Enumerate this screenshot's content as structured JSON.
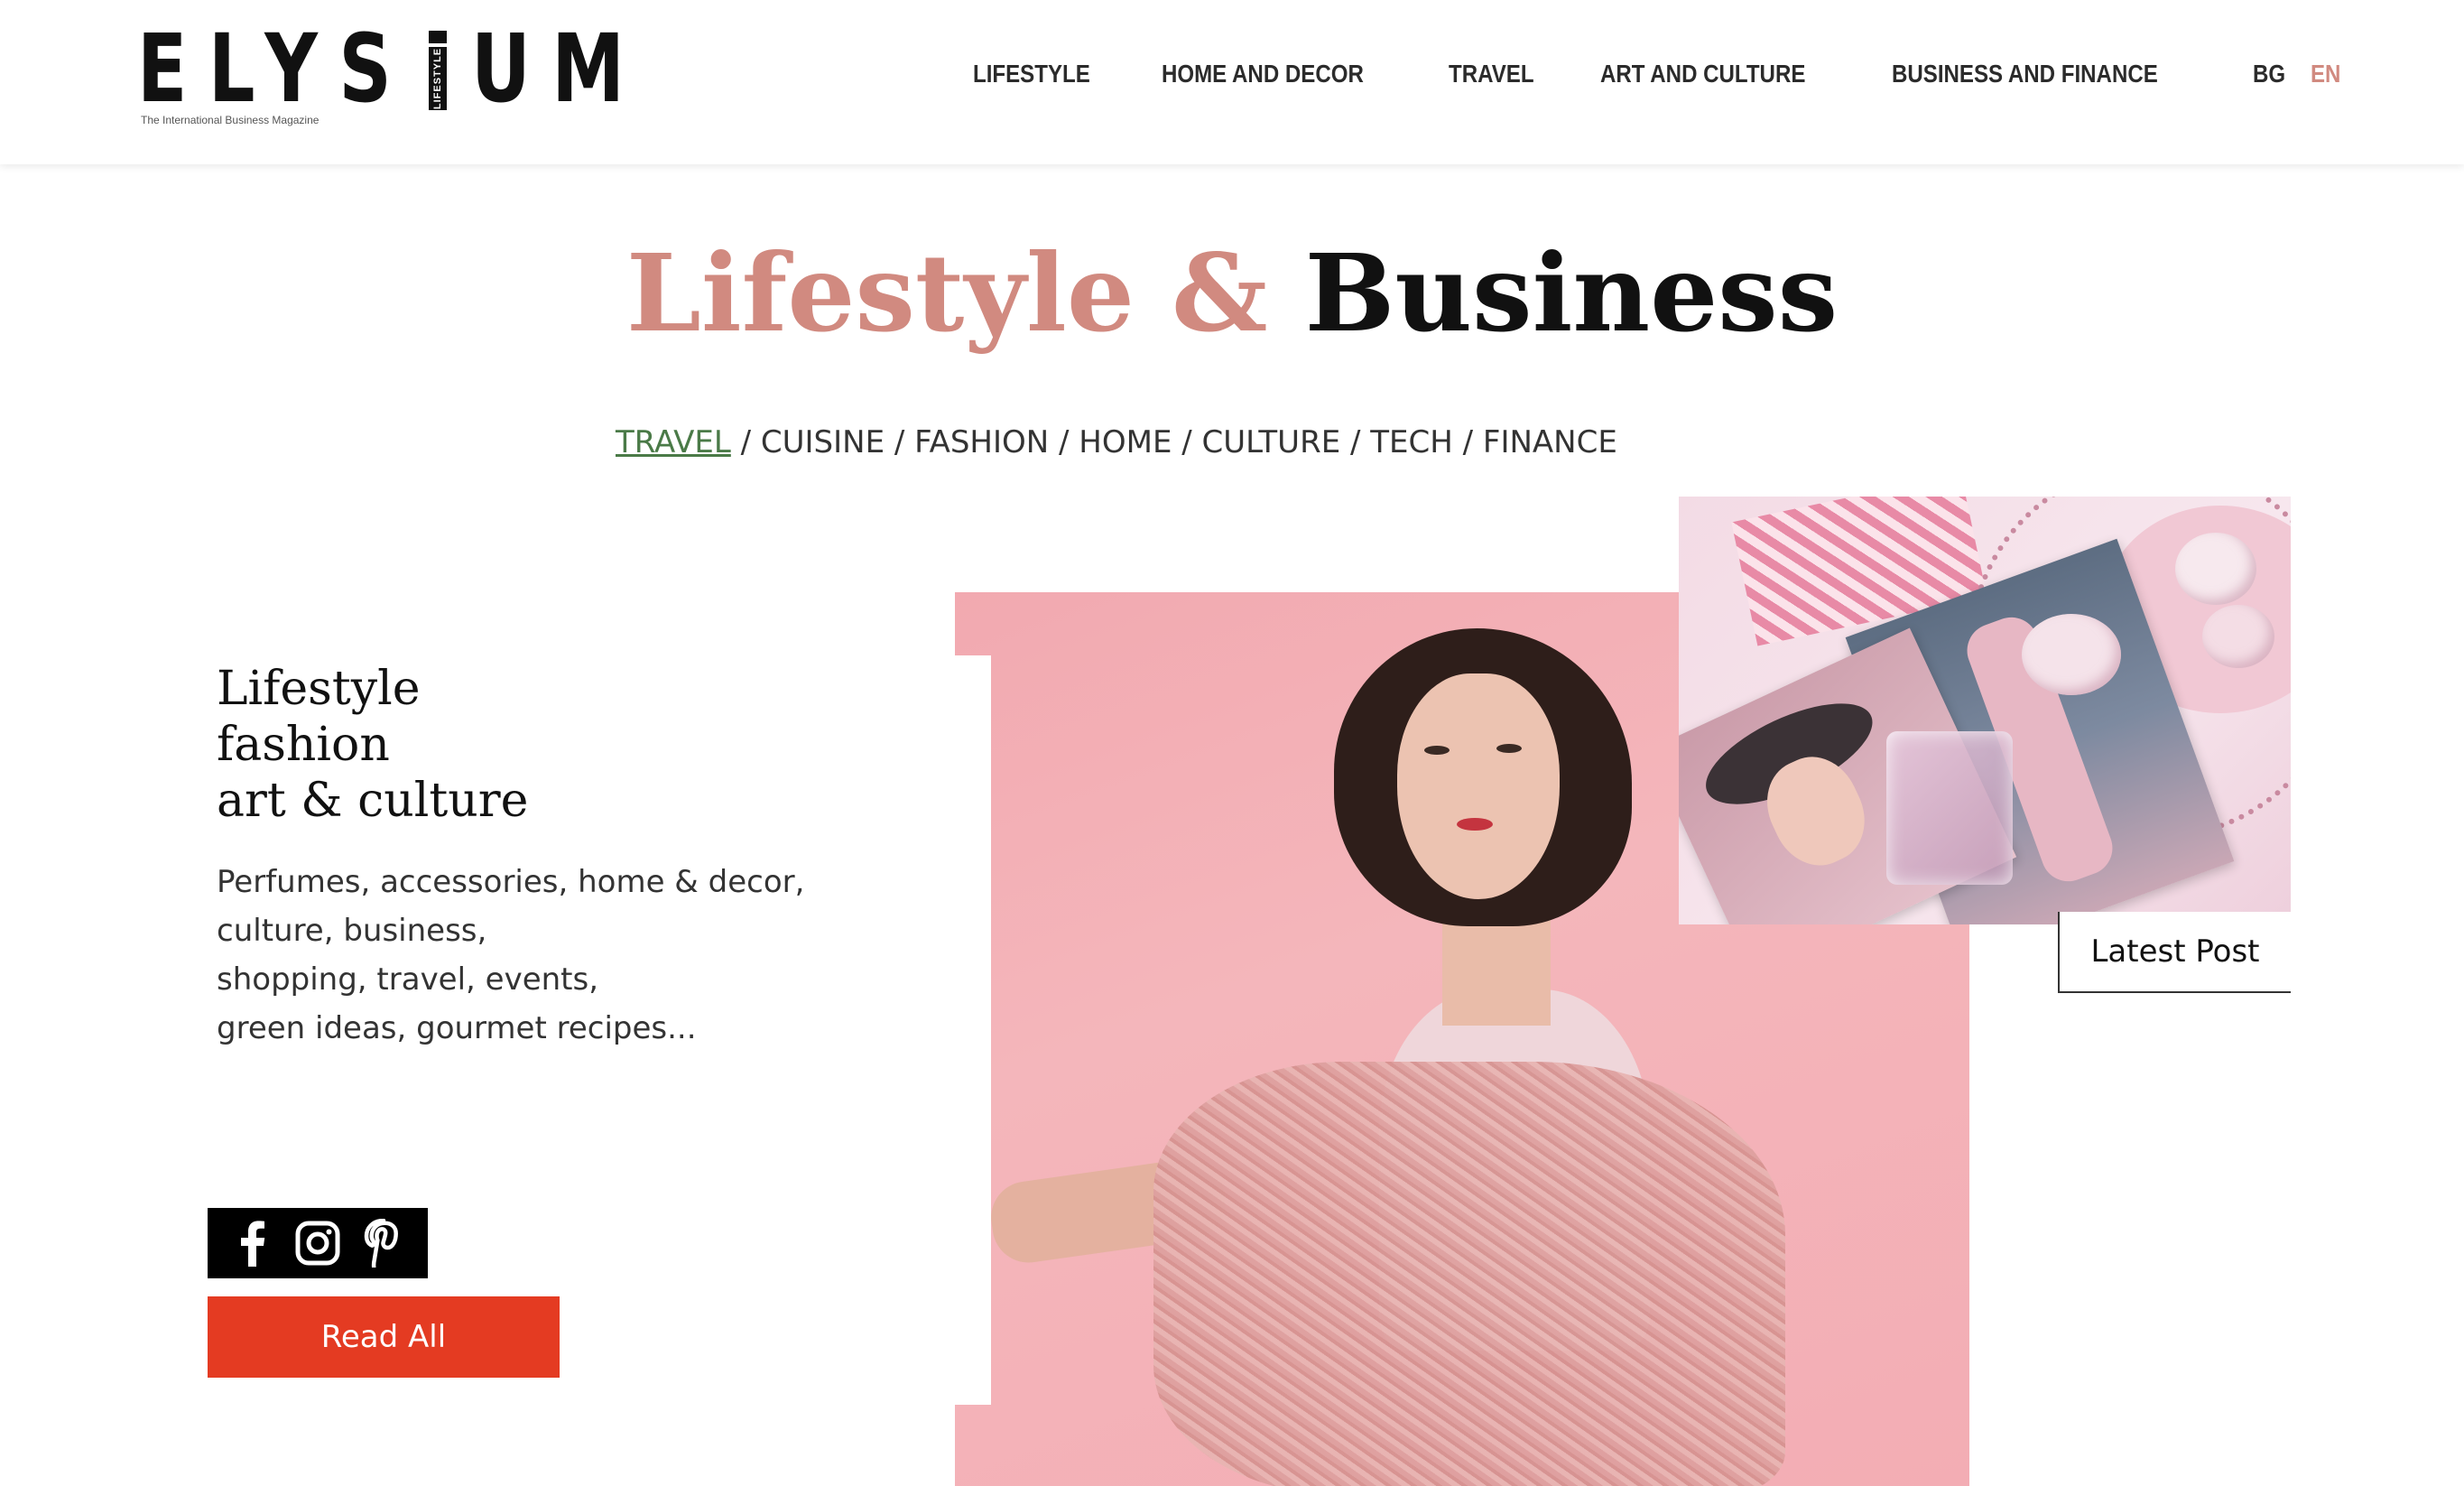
{
  "header": {
    "logo": {
      "left_letters": "ELYS",
      "right_letters": "UM",
      "vertical_text": "LIFESTYLE",
      "tagline": "The International Business Magazine"
    },
    "nav": [
      {
        "label": "LIFESTYLE"
      },
      {
        "label": "HOME AND DECOR"
      },
      {
        "label": "TRAVEL"
      },
      {
        "label": "ART AND CULTURE"
      },
      {
        "label": "BUSINESS AND FINANCE"
      }
    ],
    "languages": [
      {
        "label": "BG",
        "color": "#2b2b2b"
      },
      {
        "label": "EN",
        "color": "#d18a80"
      }
    ]
  },
  "hero": {
    "title_light": "Lifestyle &",
    "title_dark": "Business",
    "light_color": "#d18a80",
    "dark_color": "#111111"
  },
  "categories": [
    {
      "label": "TRAVEL",
      "active": true
    },
    {
      "label": "CUISINE",
      "active": false
    },
    {
      "label": "FASHION",
      "active": false
    },
    {
      "label": "HOME",
      "active": false
    },
    {
      "label": "CULTURE",
      "active": false
    },
    {
      "label": "TECH",
      "active": false
    },
    {
      "label": "FINANCE",
      "active": false
    }
  ],
  "category_separator": " / ",
  "intro": {
    "heading": [
      "Lifestyle",
      "fashion",
      "art & culture"
    ],
    "body": [
      "Perfumes, accessories, home & decor,",
      "culture, business,",
      "shopping, travel, events,",
      "green ideas, gourmet recipes..."
    ]
  },
  "social": {
    "icons": [
      "facebook-icon",
      "instagram-icon",
      "pinterest-icon"
    ]
  },
  "buttons": {
    "read_all": "Read All",
    "read_all_color": "#e43b22",
    "latest_post": "Latest Post"
  }
}
